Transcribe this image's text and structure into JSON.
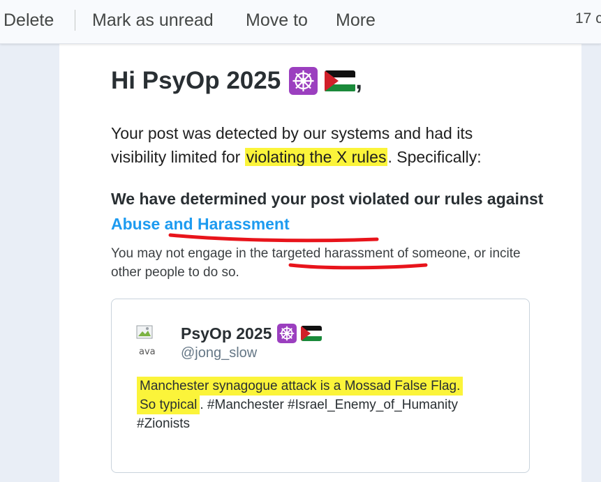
{
  "toolbar": {
    "delete_label": "Delete",
    "mark_unread_label": "Mark as unread",
    "move_to_label": "Move to",
    "more_label": "More",
    "count_text": "17 c"
  },
  "email": {
    "greeting_text": "Hi PsyOp 2025",
    "greeting_suffix": ",",
    "paragraph_before": "Your post was detected by our systems and had its visibility limited for",
    "paragraph_highlight": "violating the X rules",
    "paragraph_after": ". Specifically:",
    "determined_text": "We have determined your post violated our rules against",
    "rule_link": "Abuse and Harassment",
    "rule_description_before": "You may not engage in the ",
    "rule_description_underlined": "targeted harassment",
    "rule_description_after": " of someone, or incite other people to do so."
  },
  "tweet": {
    "avatar_alt": "ava",
    "display_name": "PsyOp 2025",
    "handle": "@jong_slow",
    "text_highlight_1": "Manchester synagogue attack is a Mossad False Flag.",
    "text_highlight_2": "So typical",
    "text_rest": ". #Manchester #Israel_Enemy_of_Humanity #Zionists"
  },
  "colors": {
    "highlight": "#fbf43a",
    "link": "#1d9bf0",
    "annotation_red": "#e8141b",
    "emoji_purple": "#9b3fbf"
  },
  "icons": {
    "emoji_1": "wheel-of-dharma-emoji",
    "emoji_2": "palestine-flag-emoji",
    "avatar": "broken-image-icon"
  }
}
